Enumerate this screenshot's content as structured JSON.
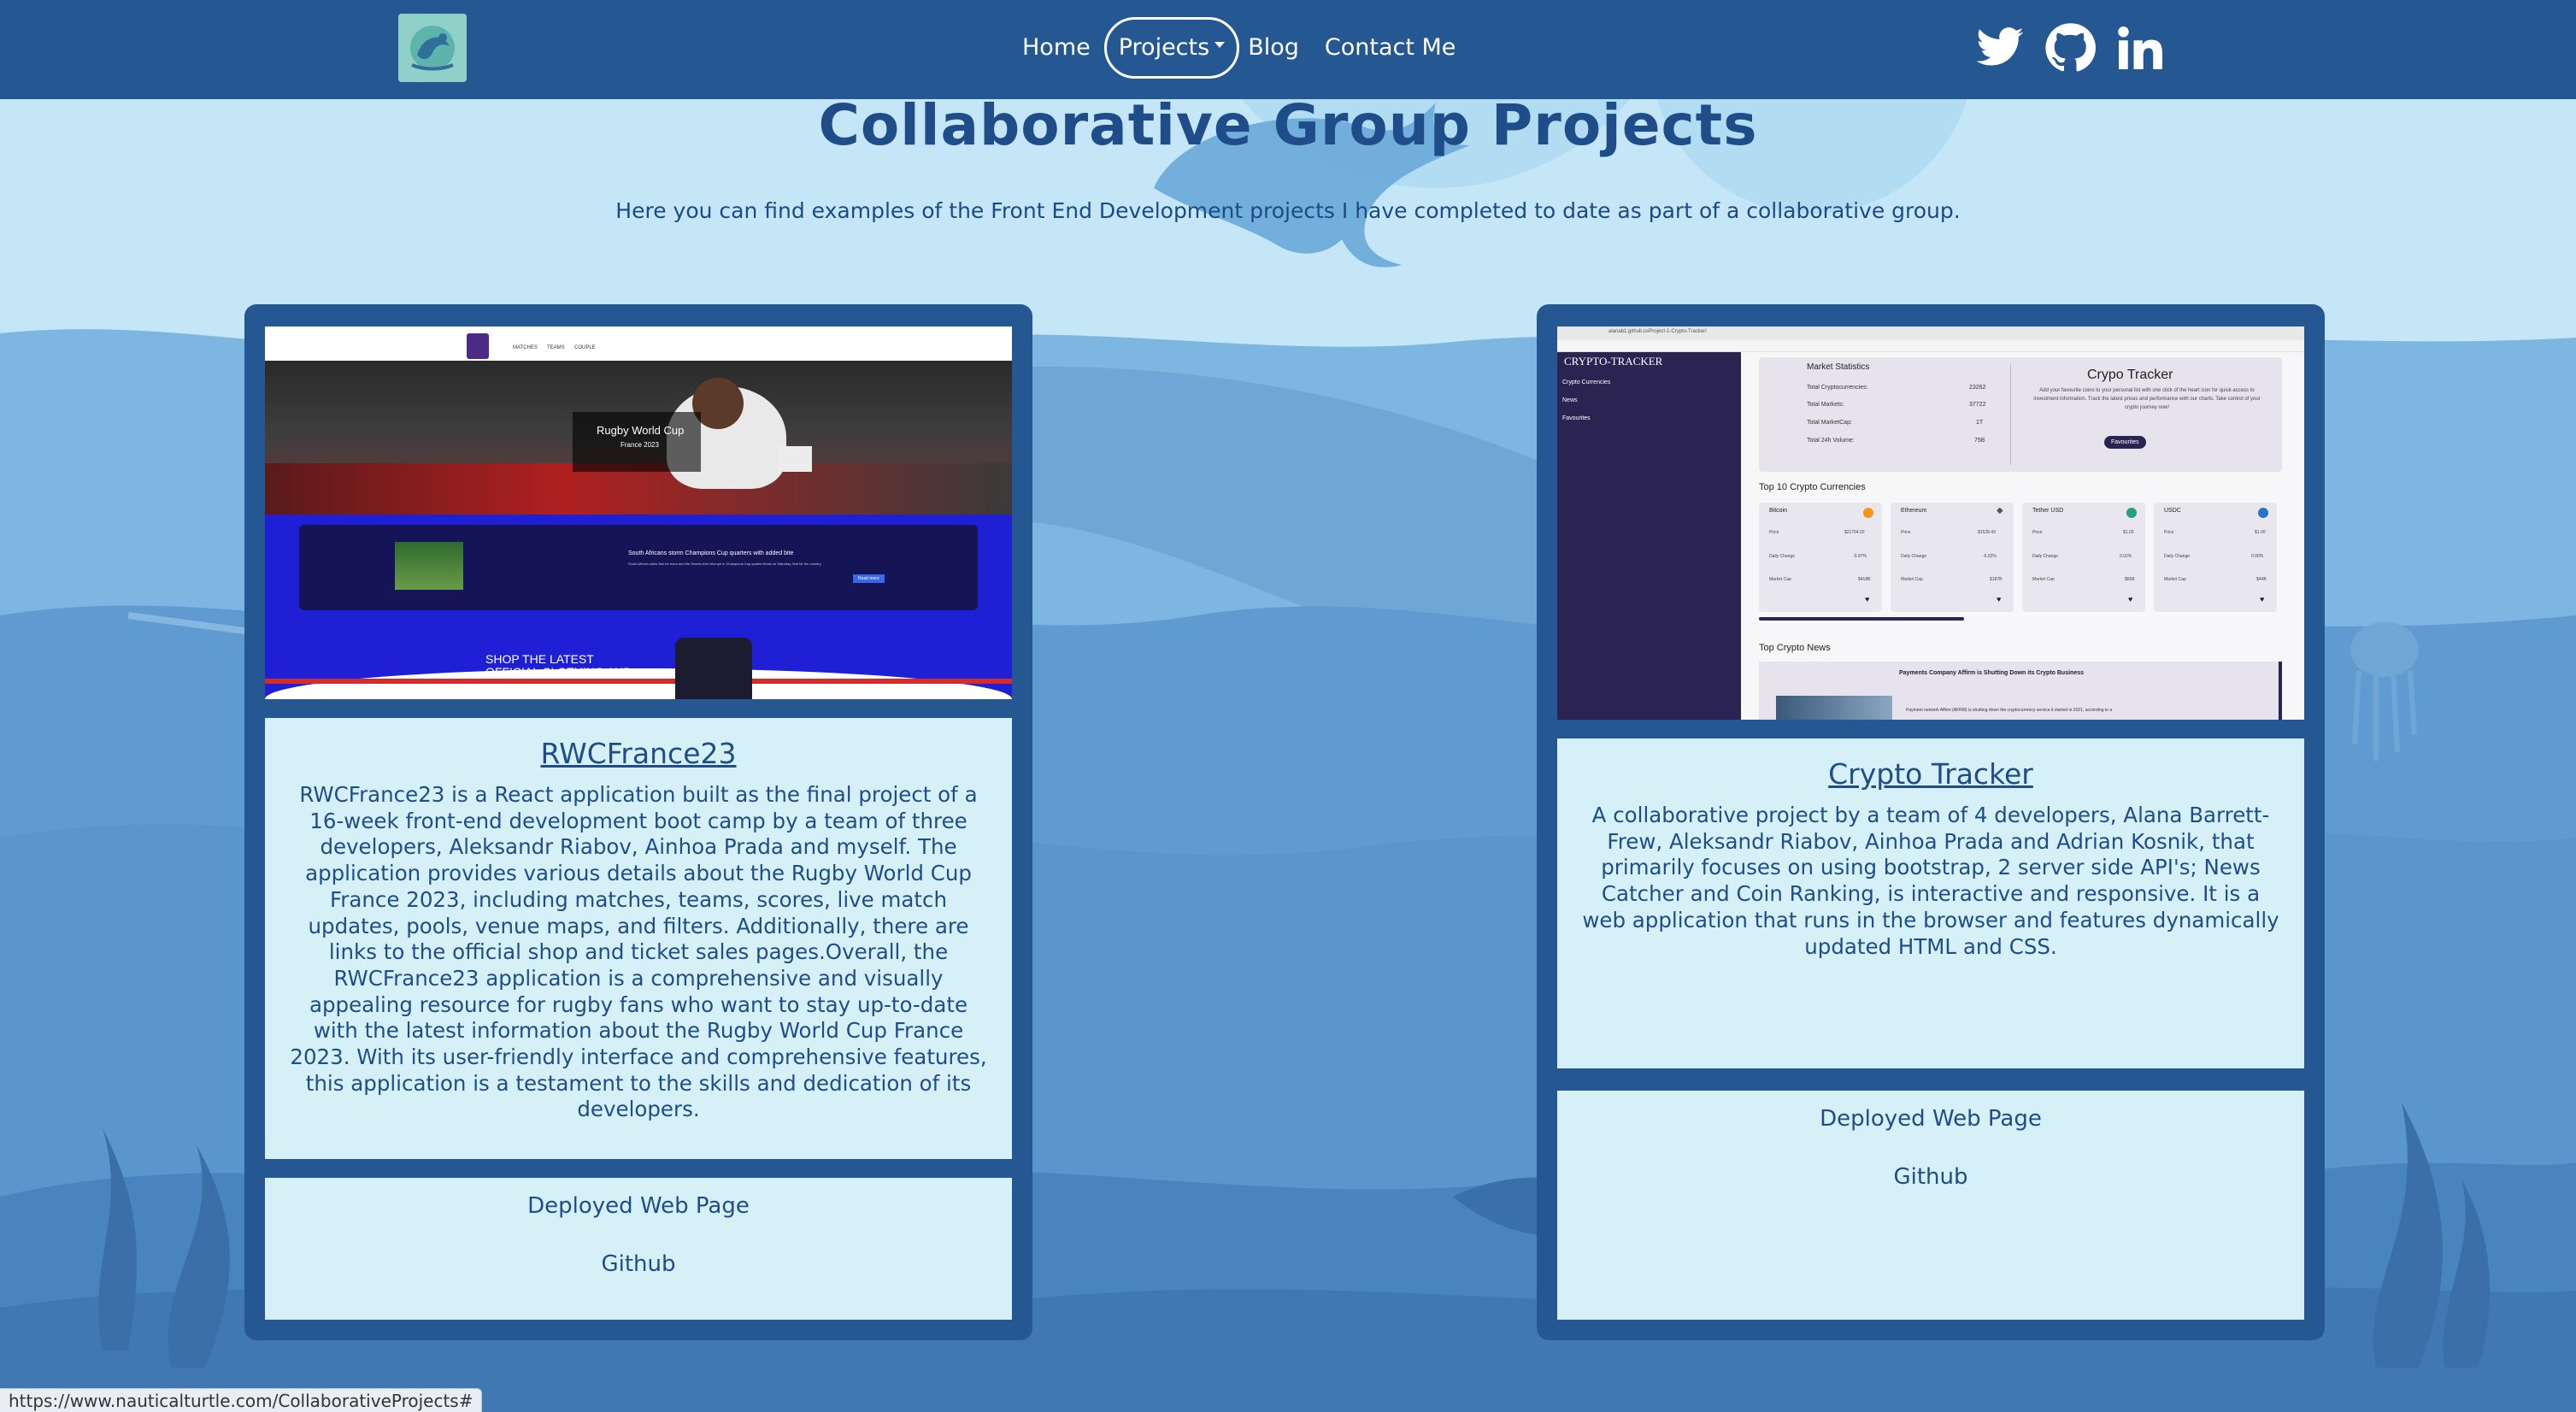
{
  "nav": {
    "home": "Home",
    "projects": "Projects",
    "blog": "Blog",
    "contact": "Contact Me",
    "social": [
      "twitter-icon",
      "github-icon",
      "linkedin-icon"
    ]
  },
  "page": {
    "title": "Collaborative Group Projects",
    "subtitle": "Here you can find examples of the Front End Development projects I have completed to date as part of a collaborative group."
  },
  "projects": [
    {
      "title": "RWCFrance23",
      "description": "RWCFrance23 is a React application built as the final project of a 16-week front-end development boot camp by a team of three developers, Aleksandr Riabov, Ainhoa Prada and myself. The application provides various details about the Rugby World Cup France 2023, including matches, teams, scores, live match updates, pools, venue maps, and filters. Additionally, there are links to the official shop and ticket sales pages.Overall, the RWCFrance23 application is a comprehensive and visually appealing resource for rugby fans who want to stay up-to-date with the latest information about the Rugby World Cup France 2023. With its user-friendly interface and comprehensive features, this application is a testament to the skills and dedication of its developers.",
      "deployed": "Deployed Web Page",
      "github": "Github",
      "preview": {
        "hero_title": "Rugby World Cup",
        "hero_sub": "France 2023",
        "nav": [
          "MATCHES",
          "TEAMS",
          "COUPLE"
        ],
        "news_headline": "South Africans storm Champions Cup quarters with added bite",
        "news_body": "South African sides Bull for team and the Sharks both triumph in Champions Cup quarter-finals on Saturday, Bull for the country",
        "news_button": "Read more",
        "shop_text": "SHOP THE LATEST OFFICIAL CLOTHING AND"
      }
    },
    {
      "title": "Crypto Tracker",
      "description": "A collaborative project by a team of 4 developers, Alana Barrett-Frew, Aleksandr Riabov, Ainhoa Prada and Adrian Kosnik, that primarily focuses on using bootstrap, 2 server side API's; News Catcher and Coin Ranking, is interactive and responsive. It is a web application that runs in the browser and features dynamically updated HTML and CSS.",
      "deployed": "Deployed Web Page",
      "github": "Github",
      "preview": {
        "brand": "CRYPTO-TRACKER",
        "side_items": [
          "Crypto Currencies",
          "News",
          "Favourites"
        ],
        "stats_title": "Market Statistics",
        "stats": [
          {
            "label": "Total Cryptocurrencies:",
            "value": "23262"
          },
          {
            "label": "Total Markets:",
            "value": "37722"
          },
          {
            "label": "Total MarketCap:",
            "value": "1T"
          },
          {
            "label": "Total 24h Volume:",
            "value": "75B"
          }
        ],
        "tracker_title": "Crypo Tracker",
        "tracker_text": "Add your favourite coins to your personal list with one click of the heart icon for quick access to investment information. Track the latest prices and performance with our charts. Take control of your crypto journey now!",
        "favourites_btn": "Favourites",
        "top10_title": "Top 10 Crypto Currencies",
        "coins": [
          {
            "name": "Bitcoin",
            "price": "$21764.02",
            "change": "-3.97%",
            "cap": "$418B",
            "color": "#f7931a"
          },
          {
            "name": "Ethereum",
            "price": "$1528.43",
            "change": "-6.52%",
            "cap": "$187B",
            "color": "#555555"
          },
          {
            "name": "Tether USD",
            "price": "$1.00",
            "change": "0.02%",
            "cap": "$66B",
            "color": "#26a17b"
          },
          {
            "name": "USDC",
            "price": "$1.00",
            "change": "0.00%",
            "cap": "$44B",
            "color": "#2775ca"
          }
        ],
        "price_label": "Price",
        "change_label": "Daily Change",
        "cap_label": "Market Cap",
        "news_title": "Top Crypto News",
        "news_headline": "Payments Company Affirm is Shutting Down its Crypto Business",
        "news_body": "Payment network Affirm (AFRM) is shutting down the cryptocurrency service it started in 2021, according to a",
        "browser_url": "alanab1.github.io/Project-1-Crypto-Tracker/"
      }
    }
  ],
  "status_url": "https://www.nauticalturtle.com/CollaborativeProjects#",
  "colors": {
    "navbar": "#255892",
    "background": "#bfe3f5",
    "card_border": "#255892",
    "card_body": "#d6f0f8",
    "text": "#1f4d8a"
  }
}
